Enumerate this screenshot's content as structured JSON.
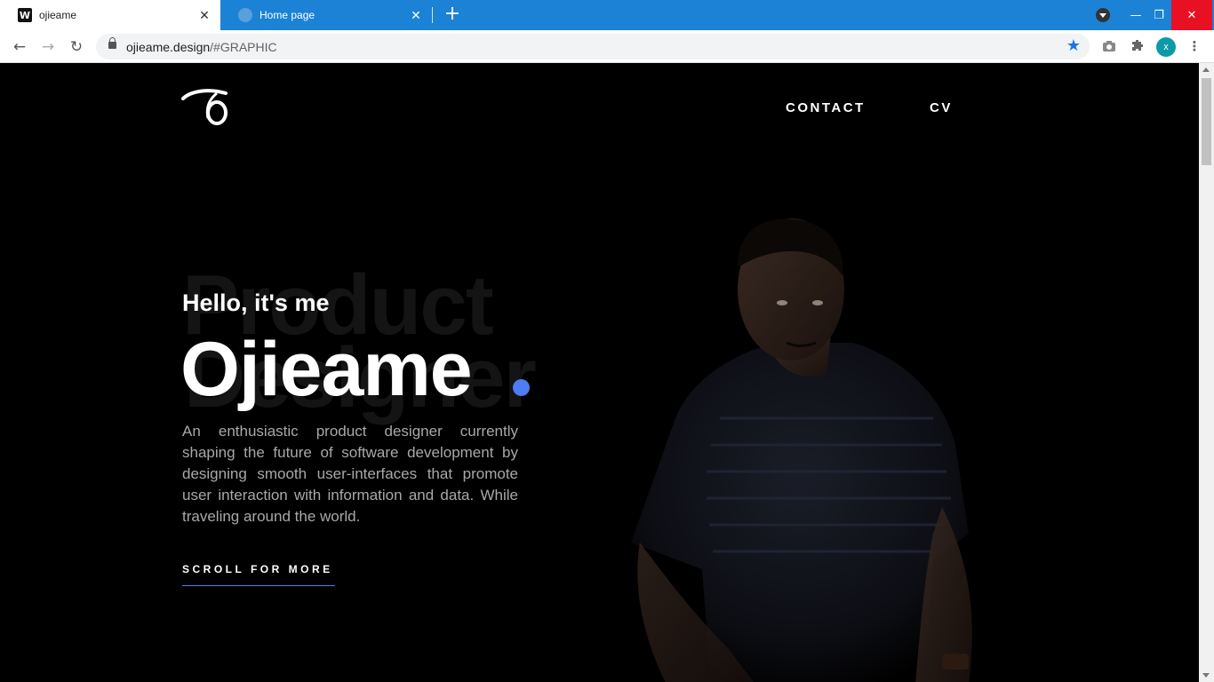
{
  "browser": {
    "tabs": [
      {
        "title": "ojieame",
        "favicon": "W",
        "active": true
      },
      {
        "title": "Home page",
        "favicon": "globe",
        "active": false
      }
    ],
    "new_tab_symbol": "+",
    "url_host": "ojieame.design",
    "url_rest": "/#GRAPHIC",
    "profile_initial": "x",
    "window_controls": [
      "minimize",
      "restore",
      "close"
    ]
  },
  "page": {
    "nav": {
      "contact": "CONTACT",
      "cv": "CV"
    },
    "background_words": [
      "Product",
      "Designer"
    ],
    "greeting": "Hello, it's me",
    "name": "Ojieame",
    "bio": "An enthusiastic product designer currently shaping the future of software development by designing smooth user-interfaces that promote user interaction with information and data. While traveling around the world.",
    "cta": "SCROLL FOR MORE",
    "accent_color": "#4e7cf4"
  }
}
